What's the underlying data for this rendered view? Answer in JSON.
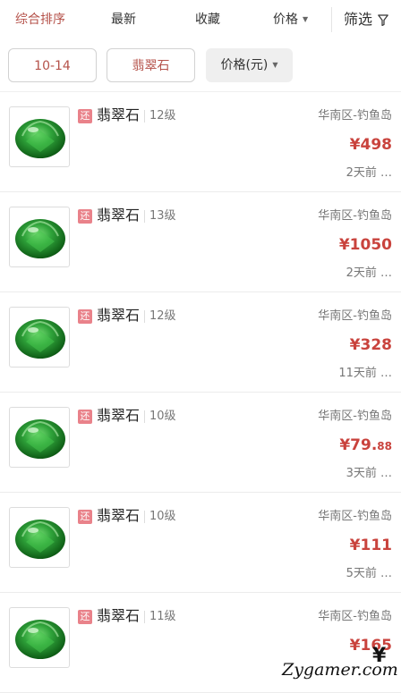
{
  "sort_bar": {
    "items": [
      {
        "label": "综合排序",
        "active": true
      },
      {
        "label": "最新",
        "active": false
      },
      {
        "label": "收藏",
        "active": false
      },
      {
        "label": "价格",
        "active": false,
        "caret": "▼"
      }
    ],
    "filter_label": "筛选",
    "filter_icon": "funnel-icon"
  },
  "filter_chips": {
    "level_range": "10-14",
    "item_name": "翡翠石",
    "price_sort": "价格(元)",
    "caret": "▼"
  },
  "colors": {
    "accent": "#b5524a",
    "price": "#c9433d",
    "badge": "#e9828a",
    "gem": "#2fa33a"
  },
  "listings": [
    {
      "badge": "还",
      "name": "翡翠石",
      "level": "12级",
      "region": "华南区-钓鱼岛",
      "price": "¥498",
      "price_cents": "",
      "time": "2天前 …",
      "icon": "emerald-gem-icon"
    },
    {
      "badge": "还",
      "name": "翡翠石",
      "level": "13级",
      "region": "华南区-钓鱼岛",
      "price": "¥1050",
      "price_cents": "",
      "time": "2天前 …",
      "icon": "emerald-gem-icon"
    },
    {
      "badge": "还",
      "name": "翡翠石",
      "level": "12级",
      "region": "华南区-钓鱼岛",
      "price": "¥328",
      "price_cents": "",
      "time": "11天前 …",
      "icon": "emerald-gem-icon"
    },
    {
      "badge": "还",
      "name": "翡翠石",
      "level": "10级",
      "region": "华南区-钓鱼岛",
      "price": "¥79.",
      "price_cents": "88",
      "time": "3天前 …",
      "icon": "emerald-gem-icon"
    },
    {
      "badge": "还",
      "name": "翡翠石",
      "level": "10级",
      "region": "华南区-钓鱼岛",
      "price": "¥111",
      "price_cents": "",
      "time": "5天前 …",
      "icon": "emerald-gem-icon"
    },
    {
      "badge": "还",
      "name": "翡翠石",
      "level": "11级",
      "region": "华南区-钓鱼岛",
      "price": "¥165",
      "price_cents": "",
      "time": "",
      "icon": "emerald-gem-icon"
    }
  ],
  "watermark": {
    "text": "Zygamer.com"
  }
}
